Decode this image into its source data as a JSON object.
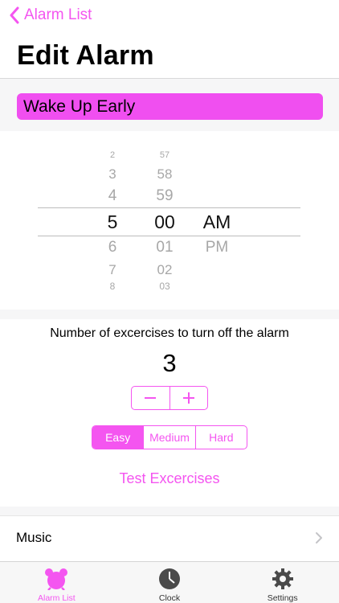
{
  "nav": {
    "back_label": "Alarm List"
  },
  "page": {
    "title": "Edit Alarm"
  },
  "alarm": {
    "name": "Wake Up Early"
  },
  "picker": {
    "hours": [
      "2",
      "3",
      "4",
      "5",
      "6",
      "7",
      "8"
    ],
    "minutes": [
      "57",
      "58",
      "59",
      "00",
      "01",
      "02",
      "03"
    ],
    "periods": [
      "AM",
      "PM"
    ],
    "selected": {
      "hour": "5",
      "minute": "00",
      "period": "AM"
    }
  },
  "exercises": {
    "label": "Number of excercises to turn off the alarm",
    "count": "3",
    "difficulties": [
      "Easy",
      "Medium",
      "Hard"
    ],
    "selected_difficulty": "Easy",
    "test_label": "Test Excercises"
  },
  "music": {
    "label": "Music"
  },
  "tabbar": {
    "tabs": [
      {
        "label": "Alarm List",
        "icon": "alarm-icon",
        "active": true
      },
      {
        "label": "Clock",
        "icon": "clock-icon",
        "active": false
      },
      {
        "label": "Settings",
        "icon": "gear-icon",
        "active": false
      }
    ]
  },
  "colors": {
    "accent": "#f455f0",
    "name_field": "#f04ff0",
    "band": "#f6f6f7"
  }
}
